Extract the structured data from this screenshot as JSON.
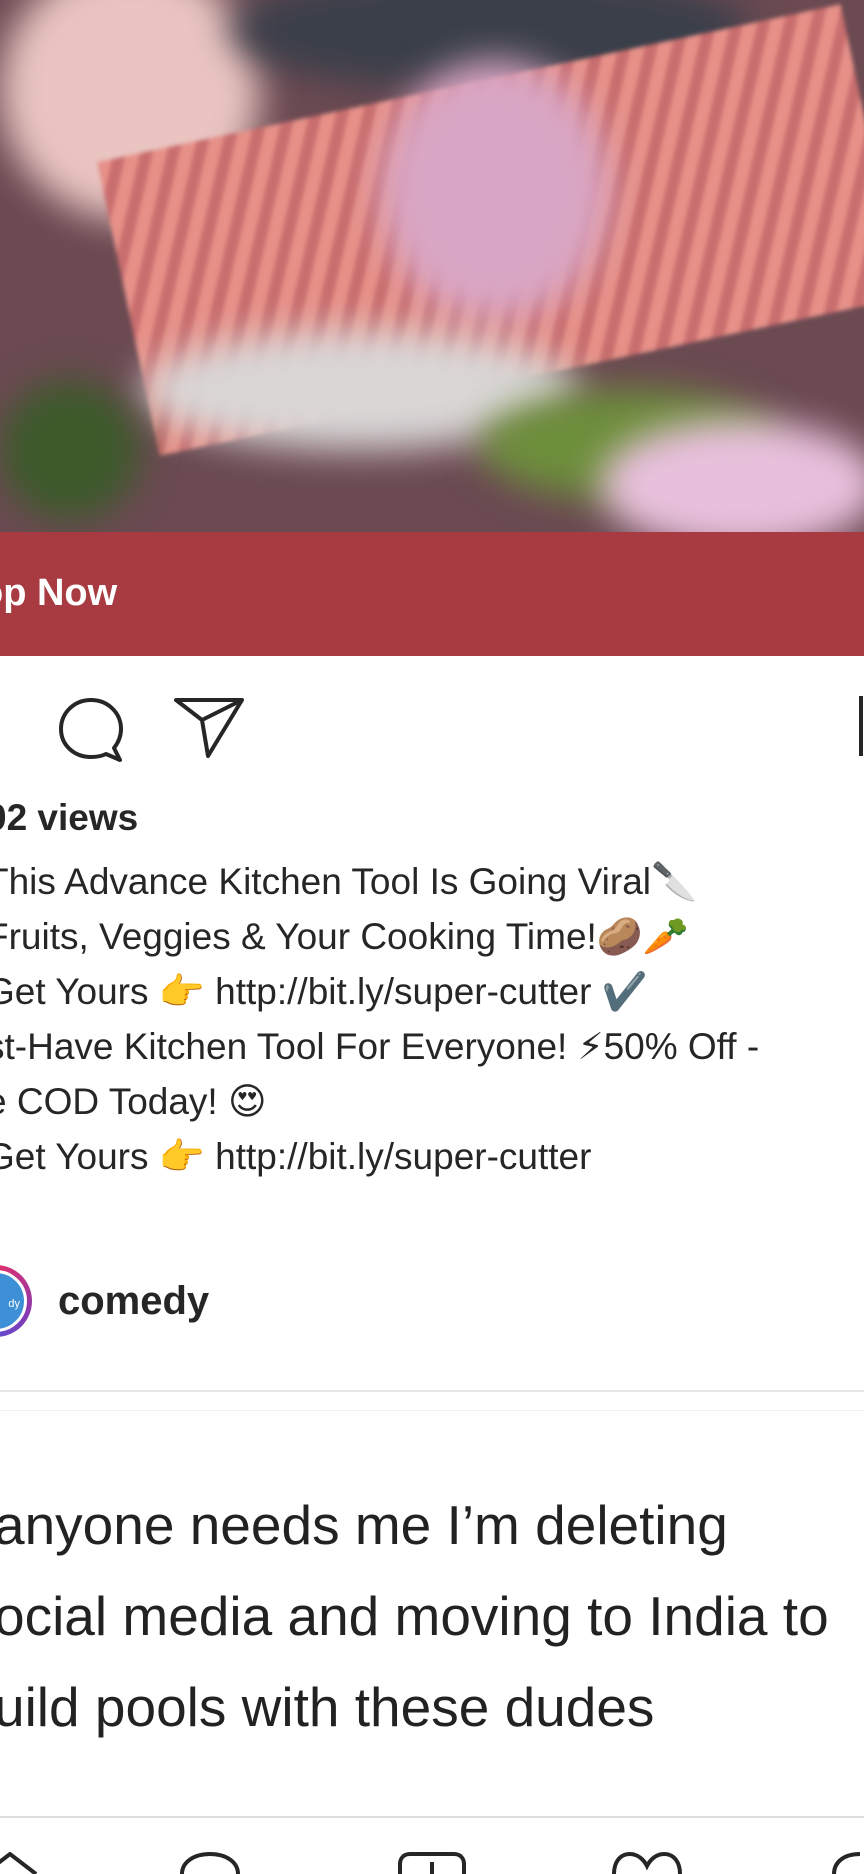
{
  "shop": {
    "label": "op Now"
  },
  "post": {
    "views": "02 views",
    "caption_lines": [
      "This Advance Kitchen Tool Is Going Viral🔪",
      " Fruits, Veggies & Your Cooking Time!🥔🥕",
      "Get Yours 👉 http://bit.ly/super-cutter ✔️",
      "st-Have Kitchen Tool For Everyone! ⚡50% Off -",
      "e COD Today! 😍",
      "Get Yours 👉 http://bit.ly/super-cutter"
    ]
  },
  "next_post": {
    "author": "comedy",
    "avatar_text": "dy",
    "tweet_lines": [
      "anyone needs me I’m deleting",
      "ocial media and moving to India to",
      "uild pools with these dudes"
    ]
  },
  "icons": {
    "like": "heart-icon",
    "comment": "comment-icon",
    "share": "send-icon",
    "save": "bookmark-icon",
    "shop_arrow": "chevron-right-icon",
    "nav": [
      "home-icon",
      "search-icon",
      "add-post-icon",
      "activity-heart-icon",
      "profile-icon"
    ]
  },
  "colors": {
    "shop_bar": "#a83a42",
    "text": "#262626",
    "accent_avatar": "#3d8fd6"
  }
}
